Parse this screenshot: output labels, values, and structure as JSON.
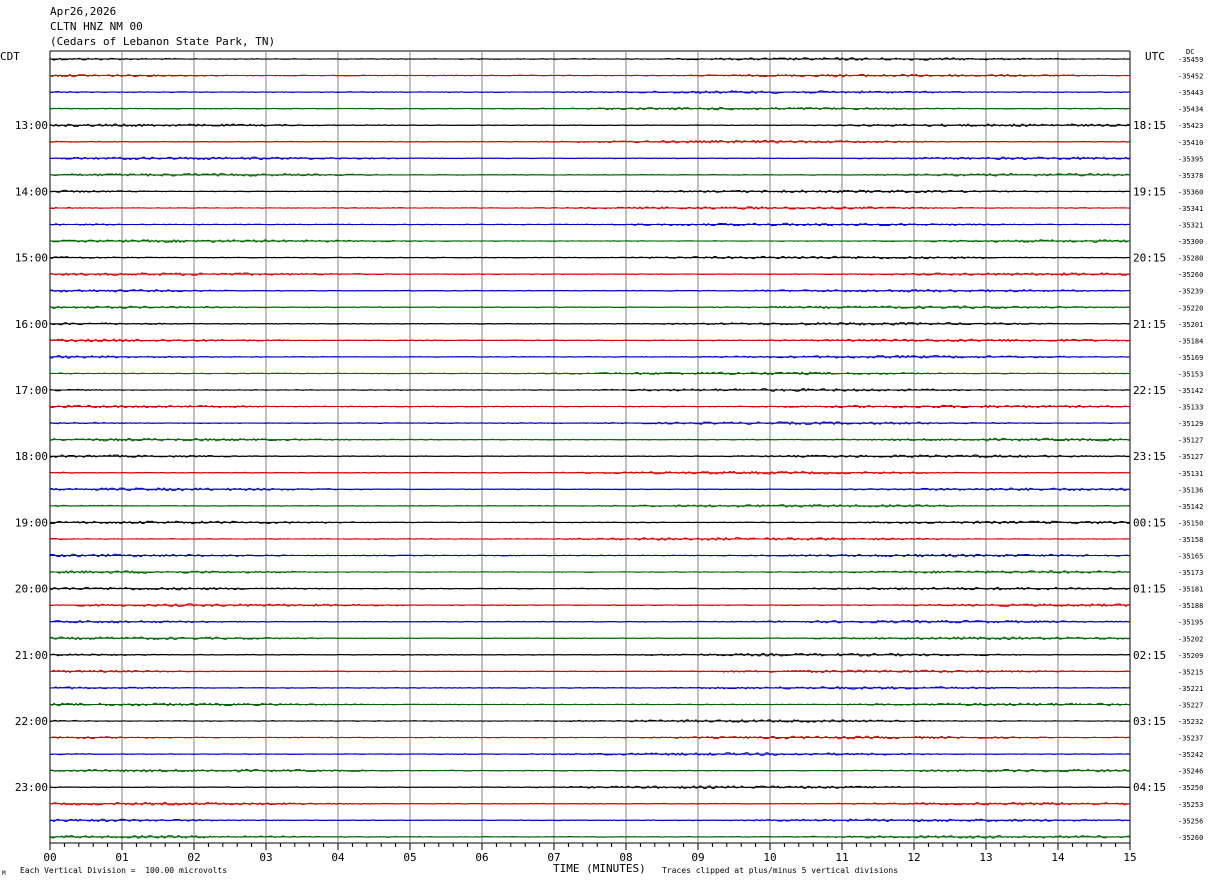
{
  "header": {
    "date": "Apr26,2026",
    "station": "CLTN HNZ NM 00",
    "location": "(Cedars of Lebanon State Park, TN)"
  },
  "left_timezone": "CDT",
  "right_timezone": "UTC",
  "dc_label": "DC",
  "footer": {
    "scale_note": "Each Vertical Division =  100.00 microvolts",
    "clip_note": "Traces clipped at plus/minus 5 vertical divisions",
    "corner_mark": "M"
  },
  "colors": {
    "cycle": [
      "#000000",
      "#d40000",
      "#0000cc",
      "#006600"
    ],
    "grid": "#808080"
  },
  "chart_data": {
    "type": "line",
    "xlabel": "TIME (MINUTES)",
    "x_ticks": [
      "00",
      "01",
      "02",
      "03",
      "04",
      "05",
      "06",
      "07",
      "08",
      "09",
      "10",
      "11",
      "12",
      "13",
      "14",
      "15"
    ],
    "xlim": [
      0,
      15
    ],
    "rows_per_hour": 4,
    "left_hour_labels": [
      "13:00",
      "14:00",
      "15:00",
      "16:00",
      "17:00",
      "18:00",
      "19:00",
      "20:00",
      "21:00",
      "22:00",
      "23:00"
    ],
    "right_hour_labels": [
      "18:15",
      "19:15",
      "20:15",
      "21:15",
      "22:15",
      "23:15",
      "00:15",
      "01:15",
      "02:15",
      "03:15",
      "04:15"
    ],
    "dc_offsets": [
      "-35459",
      "-35452",
      "-35443",
      "-35434",
      "-35423",
      "-35410",
      "-35395",
      "-35378",
      "-35360",
      "-35341",
      "-35321",
      "-35300",
      "-35280",
      "-35260",
      "-35239",
      "-35220",
      "-35201",
      "-35184",
      "-35169",
      "-35153",
      "-35142",
      "-35133",
      "-35129",
      "-35127",
      "-35127",
      "-35131",
      "-35136",
      "-35142",
      "-35150",
      "-35158",
      "-35165",
      "-35173",
      "-35181",
      "-35188",
      "-35195",
      "-35202",
      "-35209",
      "-35215",
      "-35221",
      "-35227",
      "-35232",
      "-35237",
      "-35242",
      "-35246",
      "-35250",
      "-35253",
      "-35256",
      "-35260"
    ]
  }
}
